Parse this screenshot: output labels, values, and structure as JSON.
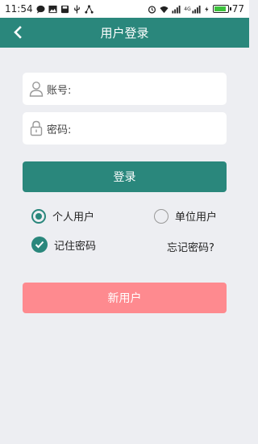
{
  "status_bar": {
    "time": "11:54",
    "network": "4G",
    "battery": "77",
    "battery_level": 0.77,
    "left_icons": [
      "chat-icon",
      "image-icon",
      "save-icon",
      "usb-icon",
      "share-icon"
    ],
    "right_icons": [
      "alarm-icon",
      "wifi-icon",
      "signal-icon",
      "signal-4g-icon",
      "charging-icon",
      "battery-icon"
    ]
  },
  "header": {
    "title": "用户登录",
    "back_icon": "chevron-left-icon"
  },
  "form": {
    "account_label": "账号:",
    "account_value": "",
    "account_icon": "user-icon",
    "password_label": "密码:",
    "password_value": "",
    "password_icon": "lock-icon",
    "login_label": "登录"
  },
  "options": {
    "personal_user": "个人用户",
    "personal_selected": true,
    "unit_user": "单位用户",
    "unit_selected": false,
    "remember_password": "记住密码",
    "remember_checked": true,
    "forgot_password": "忘记密码?"
  },
  "new_user_label": "新用户",
  "colors": {
    "primary": "#2a877c",
    "secondary_button": "#fe8a8f",
    "background": "#edeef2"
  }
}
